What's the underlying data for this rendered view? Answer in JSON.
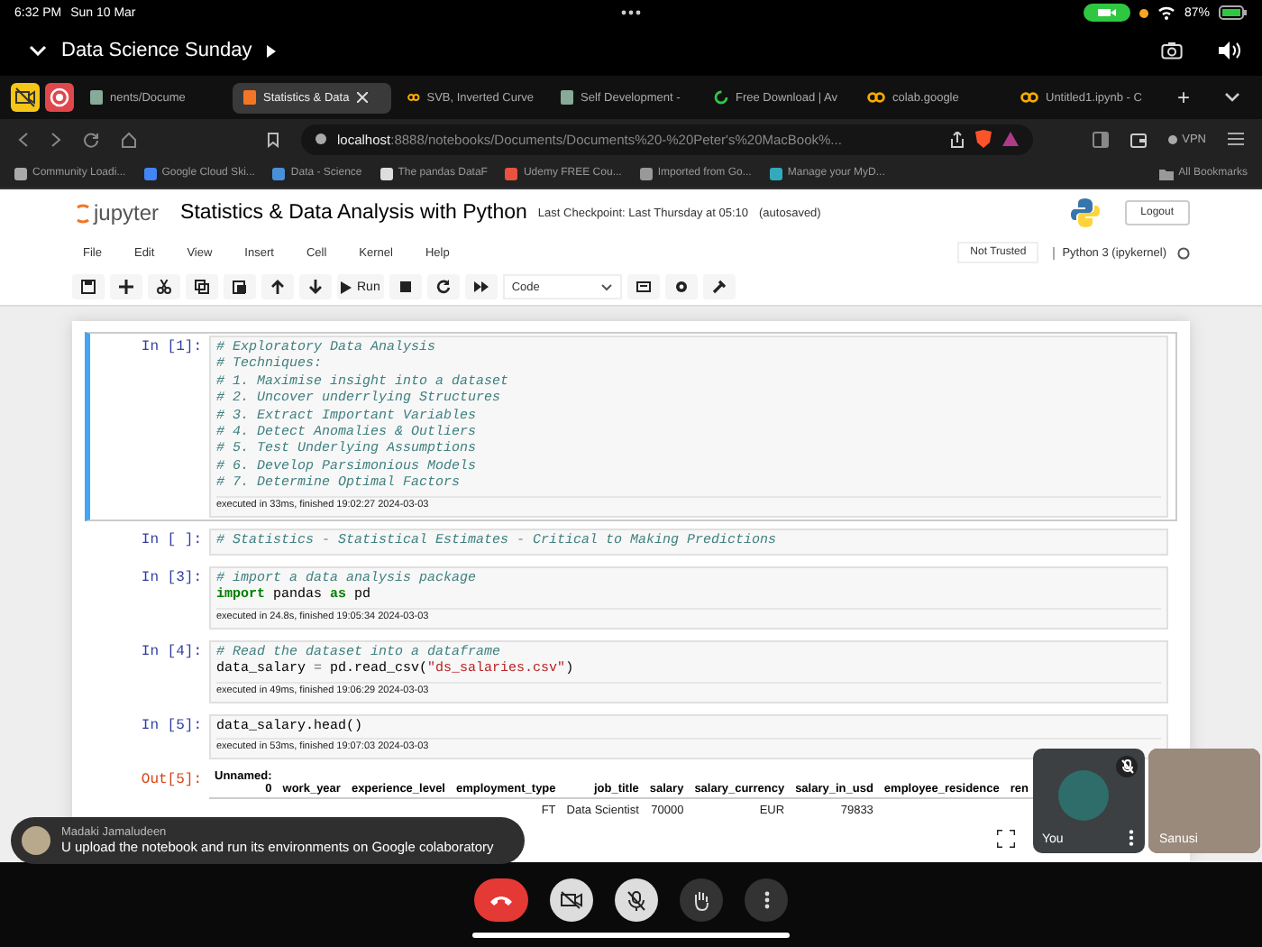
{
  "status_bar": {
    "time": "6:32 PM",
    "date": "Sun 10 Mar",
    "battery": "87%"
  },
  "meeting": {
    "title": "Data Science Sunday"
  },
  "browser": {
    "tabs": [
      {
        "label": "nents/Docume",
        "selected": false,
        "kind": "generic"
      },
      {
        "label": "Statistics & Data",
        "selected": true,
        "kind": "jupyter"
      },
      {
        "label": "SVB, Inverted Curve",
        "selected": false,
        "kind": "colab"
      },
      {
        "label": "Self Development -",
        "selected": false,
        "kind": "generic"
      },
      {
        "label": "Free Download | Av",
        "selected": false,
        "kind": "loading"
      },
      {
        "label": "colab.google",
        "selected": false,
        "kind": "colab"
      },
      {
        "label": "Untitled1.ipynb - C",
        "selected": false,
        "kind": "colab"
      }
    ],
    "new_tab": "+",
    "url_host": "localhost",
    "url_path": ":8888/notebooks/Documents/Documents%20-%20Peter's%20MacBook%...",
    "vpn": "VPN",
    "bookmarks": [
      "Community Loadi...",
      "Google Cloud Ski...",
      "Data - Science",
      "The pandas DataF",
      "Udemy FREE Cou...",
      "Imported from Go...",
      "Manage your MyD..."
    ],
    "all_bookmarks": "All Bookmarks"
  },
  "jupyter": {
    "logo": "jupyter",
    "title": "Statistics & Data Analysis with Python",
    "checkpoint": "Last Checkpoint: Last Thursday at 05:10",
    "autosaved": "(autosaved)",
    "logout": "Logout",
    "menus": [
      "File",
      "Edit",
      "View",
      "Insert",
      "Cell",
      "Kernel",
      "Help"
    ],
    "trust": "Not Trusted",
    "kernel": "Python 3 (ipykernel)",
    "run": "Run",
    "cell_type": "Code"
  },
  "cells": [
    {
      "prompt": "In [1]:",
      "selected": true,
      "lines": [
        [
          {
            "kind": "comment",
            "text": "# Exploratory Data Analysis"
          }
        ],
        [
          {
            "kind": "comment",
            "text": "# Techniques:"
          }
        ],
        [
          {
            "kind": "comment",
            "text": "# 1. Maximise insight into a dataset"
          }
        ],
        [
          {
            "kind": "comment",
            "text": "# 2. Uncover underrlying Structures"
          }
        ],
        [
          {
            "kind": "comment",
            "text": "# 3. Extract Important Variables"
          }
        ],
        [
          {
            "kind": "comment",
            "text": "# 4. Detect Anomalies & Outliers"
          }
        ],
        [
          {
            "kind": "comment",
            "text": "# 5. Test Underlying Assumptions"
          }
        ],
        [
          {
            "kind": "comment",
            "text": "# 6. Develop Parsimonious Models"
          }
        ],
        [
          {
            "kind": "comment",
            "text": "# 7. Determine Optimal Factors"
          }
        ]
      ],
      "timing": "executed in 33ms, finished 19:02:27 2024-03-03"
    },
    {
      "prompt": "In [ ]:",
      "selected": false,
      "lines": [
        [
          {
            "kind": "comment",
            "text": "# Statistics - Statistical Estimates - Critical to Making Predictions"
          }
        ]
      ]
    },
    {
      "prompt": "In [3]:",
      "selected": false,
      "lines": [
        [
          {
            "kind": "comment",
            "text": "# import a data analysis package"
          }
        ],
        [
          {
            "kind": "keyword",
            "text": "import"
          },
          {
            "kind": "plain",
            "text": " pandas "
          },
          {
            "kind": "keyword",
            "text": "as"
          },
          {
            "kind": "plain",
            "text": " pd"
          }
        ]
      ],
      "timing": "executed in 24.8s, finished 19:05:34 2024-03-03"
    },
    {
      "prompt": "In [4]:",
      "selected": false,
      "lines": [
        [
          {
            "kind": "comment",
            "text": "# Read the dataset into a dataframe"
          }
        ],
        [
          {
            "kind": "plain",
            "text": "data_salary "
          },
          {
            "kind": "operator",
            "text": "="
          },
          {
            "kind": "plain",
            "text": " pd.read_csv("
          },
          {
            "kind": "string",
            "text": "\"ds_salaries.csv\""
          },
          {
            "kind": "plain",
            "text": ")"
          }
        ]
      ],
      "timing": "executed in 49ms, finished 19:06:29 2024-03-03"
    },
    {
      "prompt": "In [5]:",
      "selected": false,
      "lines": [
        [
          {
            "kind": "plain",
            "text": "data_salary.head()"
          }
        ]
      ],
      "timing": "executed in 53ms, finished 19:07:03 2024-03-03"
    }
  ],
  "output": {
    "prompt": "Out[5]:",
    "columns": [
      "Unnamed: 0",
      "work_year",
      "experience_level",
      "employment_type",
      "job_title",
      "salary",
      "salary_currency",
      "salary_in_usd",
      "employee_residence",
      "ren"
    ],
    "rows": [
      [
        null,
        null,
        null,
        "FT",
        "Data Scientist",
        "70000",
        "EUR",
        "79833",
        null,
        null
      ]
    ]
  },
  "caption": {
    "name": "Madaki Jamaludeen",
    "text": "U upload the notebook and run its environments on Google colaboratory"
  },
  "tiles": [
    {
      "name": "You",
      "kind": "self",
      "muted": true
    },
    {
      "name": "Sanusi",
      "kind": "camera",
      "muted": false
    }
  ]
}
